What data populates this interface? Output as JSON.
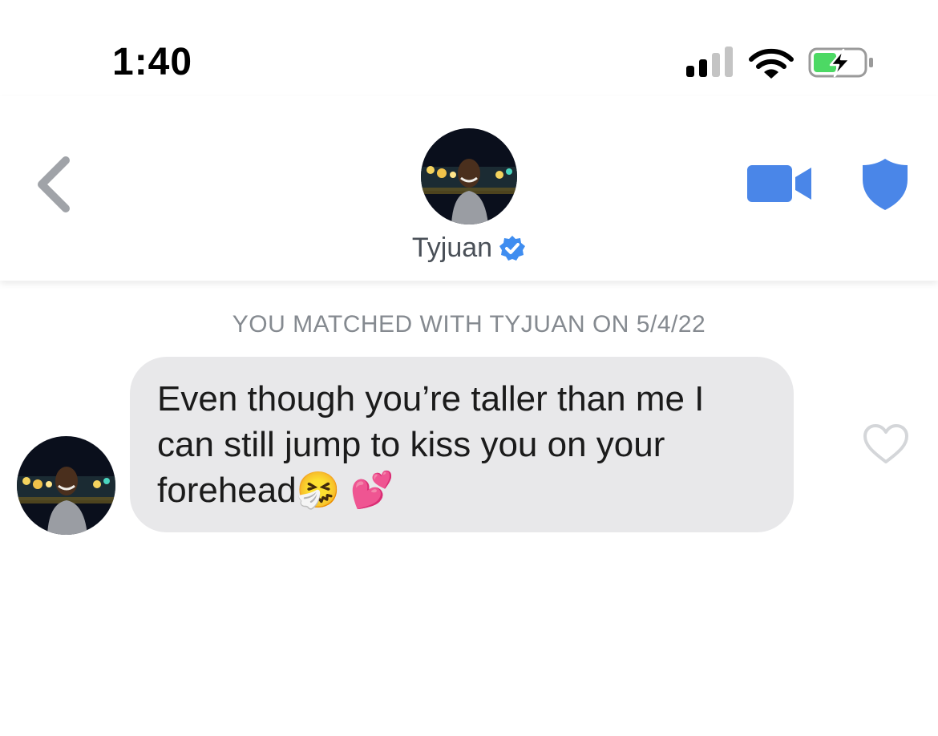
{
  "status_bar": {
    "time": "1:40"
  },
  "header": {
    "name": "Tyjuan",
    "icons": [
      "back-chevron-icon",
      "video-call-icon",
      "shield-icon",
      "verified-badge-icon"
    ]
  },
  "conversation": {
    "match_banner": "YOU MATCHED WITH TYJUAN ON 5/4/22",
    "messages": [
      {
        "sender": "Tyjuan",
        "text": "Even though you’re taller than me I can still jump to kiss you on your forehead🤧 💕"
      }
    ]
  },
  "colors": {
    "accent": "#4a86e8",
    "bubble": "#e8e8ea",
    "muted": "#858a90"
  }
}
